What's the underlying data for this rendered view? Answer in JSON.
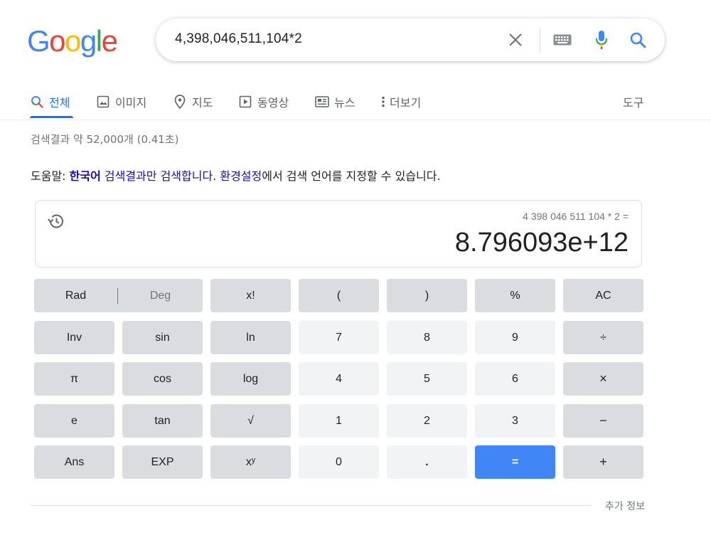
{
  "logo": {
    "letters": [
      "G",
      "o",
      "o",
      "g",
      "l",
      "e"
    ],
    "colors": [
      "#4285f4",
      "#ea4335",
      "#fbbc05",
      "#4285f4",
      "#34a853",
      "#ea4335"
    ]
  },
  "search": {
    "query": "4,398,046,511,104*2",
    "icons": [
      "close-icon",
      "keyboard-icon",
      "mic-icon",
      "search-icon"
    ]
  },
  "tabs": [
    {
      "label": "전체",
      "icon": "search-icon",
      "active": true
    },
    {
      "label": "이미지",
      "icon": "image-icon"
    },
    {
      "label": "지도",
      "icon": "map-pin-icon"
    },
    {
      "label": "동영상",
      "icon": "video-icon"
    },
    {
      "label": "뉴스",
      "icon": "news-icon"
    },
    {
      "label": "더보기",
      "icon": "more-vert-icon"
    },
    {
      "label": "도구"
    }
  ],
  "result_stats": "검색결과 약 52,000개 (0.41초)",
  "help": {
    "prefix": "도움말: ",
    "lang_link": "한국어",
    "results_link": " 검색결과만 검색합니다.",
    "settings_link": " 환경설정",
    "suffix": "에서 검색 언어를 지정할 수 있습니다."
  },
  "calculator": {
    "expression": "4 398 046 511 104 * 2 =",
    "result": "8.796093e+12",
    "rad_label": "Rad",
    "deg_label": "Deg",
    "keys": {
      "fact": "x!",
      "lparen": "(",
      "rparen": ")",
      "percent": "%",
      "ac": "AC",
      "inv": "Inv",
      "sin": "sin",
      "ln": "ln",
      "d7": "7",
      "d8": "8",
      "d9": "9",
      "divide": "÷",
      "pi": "π",
      "cos": "cos",
      "log": "log",
      "d4": "4",
      "d5": "5",
      "d6": "6",
      "multiply": "×",
      "e": "e",
      "tan": "tan",
      "sqrt": "√",
      "d1": "1",
      "d2": "2",
      "d3": "3",
      "minus": "−",
      "ans": "Ans",
      "exp": "EXP",
      "pow": "xʸ",
      "d0": "0",
      "dot": ".",
      "equals": "=",
      "plus": "+"
    }
  },
  "more_info": "추가 정보",
  "accent_color": "#1a73e8",
  "link_color": "#1a0dab",
  "equals_color": "#4285f4"
}
